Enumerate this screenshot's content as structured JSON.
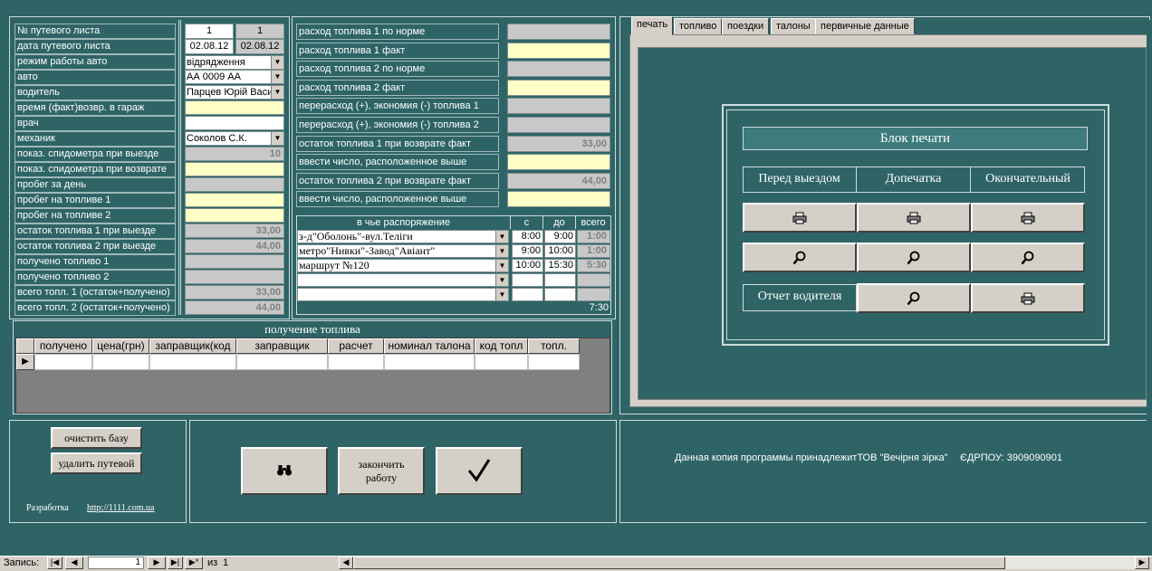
{
  "main": {
    "labels": [
      "№ путевого листа",
      "дата путевого листа",
      "режим работы авто",
      "авто",
      "водитель",
      "время (факт)возвр. в гараж",
      "врач",
      "механик",
      "показ. спидометра при выезде",
      "показ. спидометра при возврате",
      "пробег за день",
      "пробег на топливе 1",
      "пробег на топливе 2",
      "остаток  топлива 1 при выезде",
      "остаток топлива 2 при выезде",
      "получено топливо 1",
      "получено топливо 2",
      "всего топл. 1 (остаток+получено)",
      "всего топл. 2 (остаток+получено)"
    ],
    "waybill_no": "1",
    "waybill_no_prev": "1",
    "date": "02.08.12",
    "date_prev": "02.08.12",
    "mode": "відрядження",
    "car": "АА 0009 АА",
    "driver": "Парцев Юрій Васи",
    "mechanic": "Соколов С.К.",
    "odometer_out": "10",
    "fuel1_out": "33,00",
    "fuel2_out": "44,00",
    "total1": "33,00",
    "total2": "44,00"
  },
  "fuel": {
    "labels": [
      "расход топлива 1 по норме",
      "расход топлива 1 факт",
      "расход топлива 2 по норме",
      "расход топлива 2 факт",
      "перерасход (+), экономия (-) топлива 1",
      "перерасход (+), экономия (-) топлива 2",
      "остаток топлива 1 при возврате факт",
      "ввести число, расположенное выше",
      "остаток топлива 2 при возврате факт",
      "ввести число, расположенное выше"
    ],
    "remain1_return": "33,00",
    "remain2_return": "44,00"
  },
  "trips": {
    "headers": [
      "в чье распоряжение",
      "с",
      "до",
      "всего"
    ],
    "rows": [
      {
        "dest": "з-д\"Оболонь\"-вул.Теліги",
        "from": "8:00",
        "to": "9:00",
        "total": "1:00"
      },
      {
        "dest": "метро\"Нивки\"-Завод\"Авіант\"",
        "from": "9:00",
        "to": "10:00",
        "total": "1:00"
      },
      {
        "dest": "маршрут №120",
        "from": "10:00",
        "to": "15:30",
        "total": "5:30"
      }
    ],
    "grand_total": "7:30"
  },
  "fuel_receipt": {
    "title": "получение топлива",
    "headers": [
      "получено",
      "цена(грн)",
      "заправщик(код",
      "заправщик",
      "расчет",
      "номинал талона",
      "код топл",
      "топл."
    ]
  },
  "tabs": [
    "печать",
    "топливо",
    "поездки",
    "талоны",
    "первичные данные"
  ],
  "print_block": {
    "title": "Блок печати",
    "columns": [
      "Перед выездом",
      "Допечатка",
      "Окончательный"
    ],
    "driver_report": "Отчет водителя"
  },
  "bottom": {
    "clear_db": "очистить базу",
    "delete_waybill": "удалить путевой",
    "dev_label": "Разработка",
    "dev_link": "http://1111.com.ua",
    "finish_line1": "закончить",
    "finish_line2": "работу",
    "copyright": "Данная копия программы принадлежитТОВ \"Вечірня зірка\"",
    "edrpou": "ЄДРПОУ: 3909090901"
  },
  "navigator": {
    "record_label": "Запись:",
    "current": "1",
    "of_label": "из",
    "total": "1"
  }
}
